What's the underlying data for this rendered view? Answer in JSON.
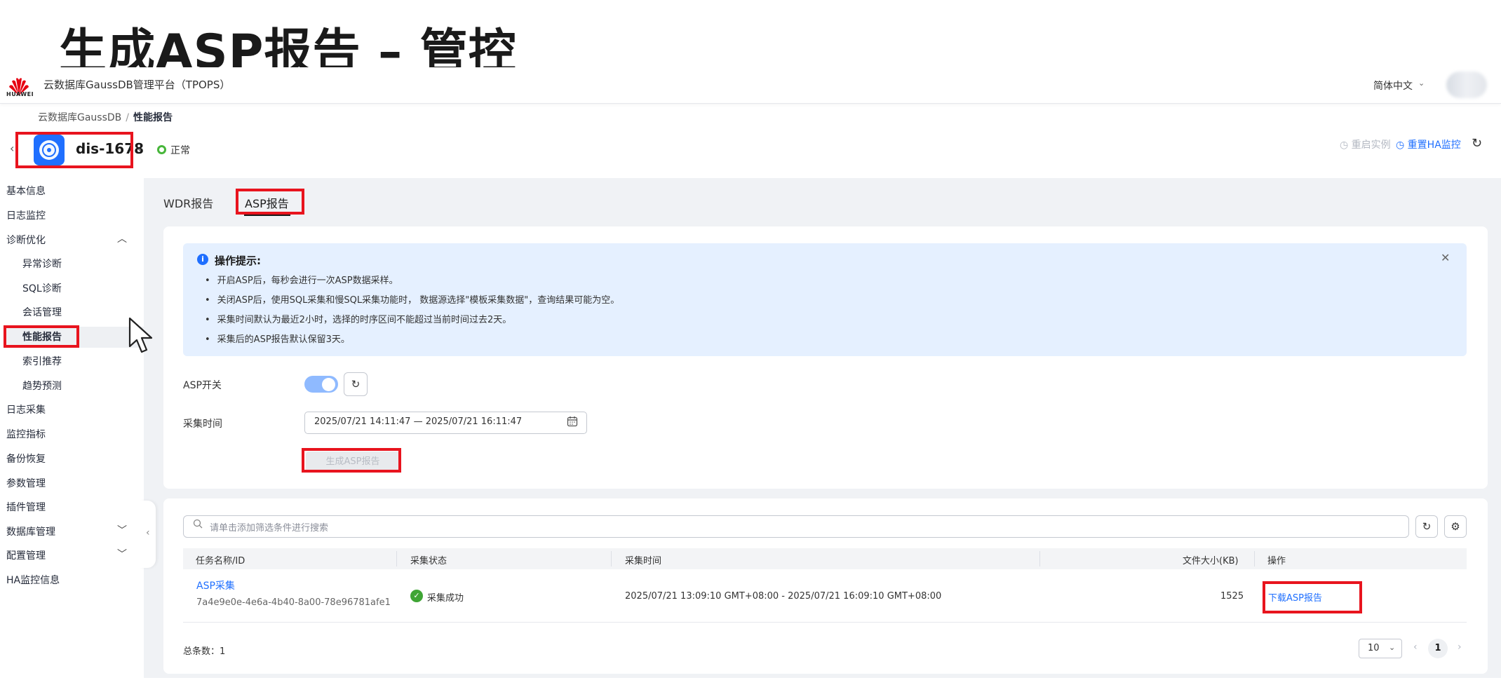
{
  "slide": {
    "title": "生成ASP报告 – 管控"
  },
  "topbar": {
    "logo_text": "HUAWEI",
    "platform_title": "云数据库GaussDB管理平台（TPOPS）",
    "language": "简体中文"
  },
  "breadcrumb": {
    "root": "云数据库GaussDB",
    "separator": "/",
    "current": "性能报告"
  },
  "instance": {
    "name": "dis-1678",
    "status": "正常",
    "actions": {
      "restart": "◷ 重启实例",
      "reset_ha": "◷ 重置HA监控"
    }
  },
  "sidebar": {
    "items": [
      {
        "label": "基本信息"
      },
      {
        "label": "日志监控"
      },
      {
        "label": "诊断优化"
      },
      {
        "label": "异常诊断"
      },
      {
        "label": "SQL诊断"
      },
      {
        "label": "会话管理"
      },
      {
        "label": "性能报告"
      },
      {
        "label": "索引推荐"
      },
      {
        "label": "趋势预测"
      },
      {
        "label": "日志采集"
      },
      {
        "label": "监控指标"
      },
      {
        "label": "备份恢复"
      },
      {
        "label": "参数管理"
      },
      {
        "label": "插件管理"
      },
      {
        "label": "数据库管理"
      },
      {
        "label": "配置管理"
      },
      {
        "label": "HA监控信息"
      }
    ]
  },
  "tabs": {
    "wdr": "WDR报告",
    "asp": "ASP报告"
  },
  "tip": {
    "title": "操作提示:",
    "lines": [
      "开启ASP后，每秒会进行一次ASP数据采样。",
      "关闭ASP后，使用SQL采集和慢SQL采集功能时， 数据源选择\"模板采集数据\"，查询结果可能为空。",
      "采集时间默认为最近2小时，选择的时序区间不能超过当前时间过去2天。",
      "采集后的ASP报告默认保留3天。"
    ]
  },
  "form": {
    "switch_label": "ASP开关",
    "switch_on": true,
    "time_label": "采集时间",
    "time_value": "2025/07/21 14:11:47 — 2025/07/21 16:11:47",
    "generate_button": "生成ASP报告"
  },
  "table": {
    "search_placeholder": "请单击添加筛选条件进行搜索",
    "columns": [
      "任务名称/ID",
      "采集状态",
      "采集时间",
      "文件大小(KB)",
      "操作"
    ],
    "rows": [
      {
        "task_name": "ASP采集",
        "task_id": "7a4e9e0e-4e6a-4b40-8a00-78e96781afe1",
        "status": "采集成功",
        "time": "2025/07/21 13:09:10 GMT+08:00 - 2025/07/21 16:09:10 GMT+08:00",
        "size": "1525",
        "action": "下载ASP报告"
      }
    ]
  },
  "pagination": {
    "total_label": "总条数：1",
    "page_size": "10",
    "current_page": "1"
  },
  "colors": {
    "accent": "#1f6fff",
    "highlight": "#e8141e",
    "success": "#3fa535"
  }
}
